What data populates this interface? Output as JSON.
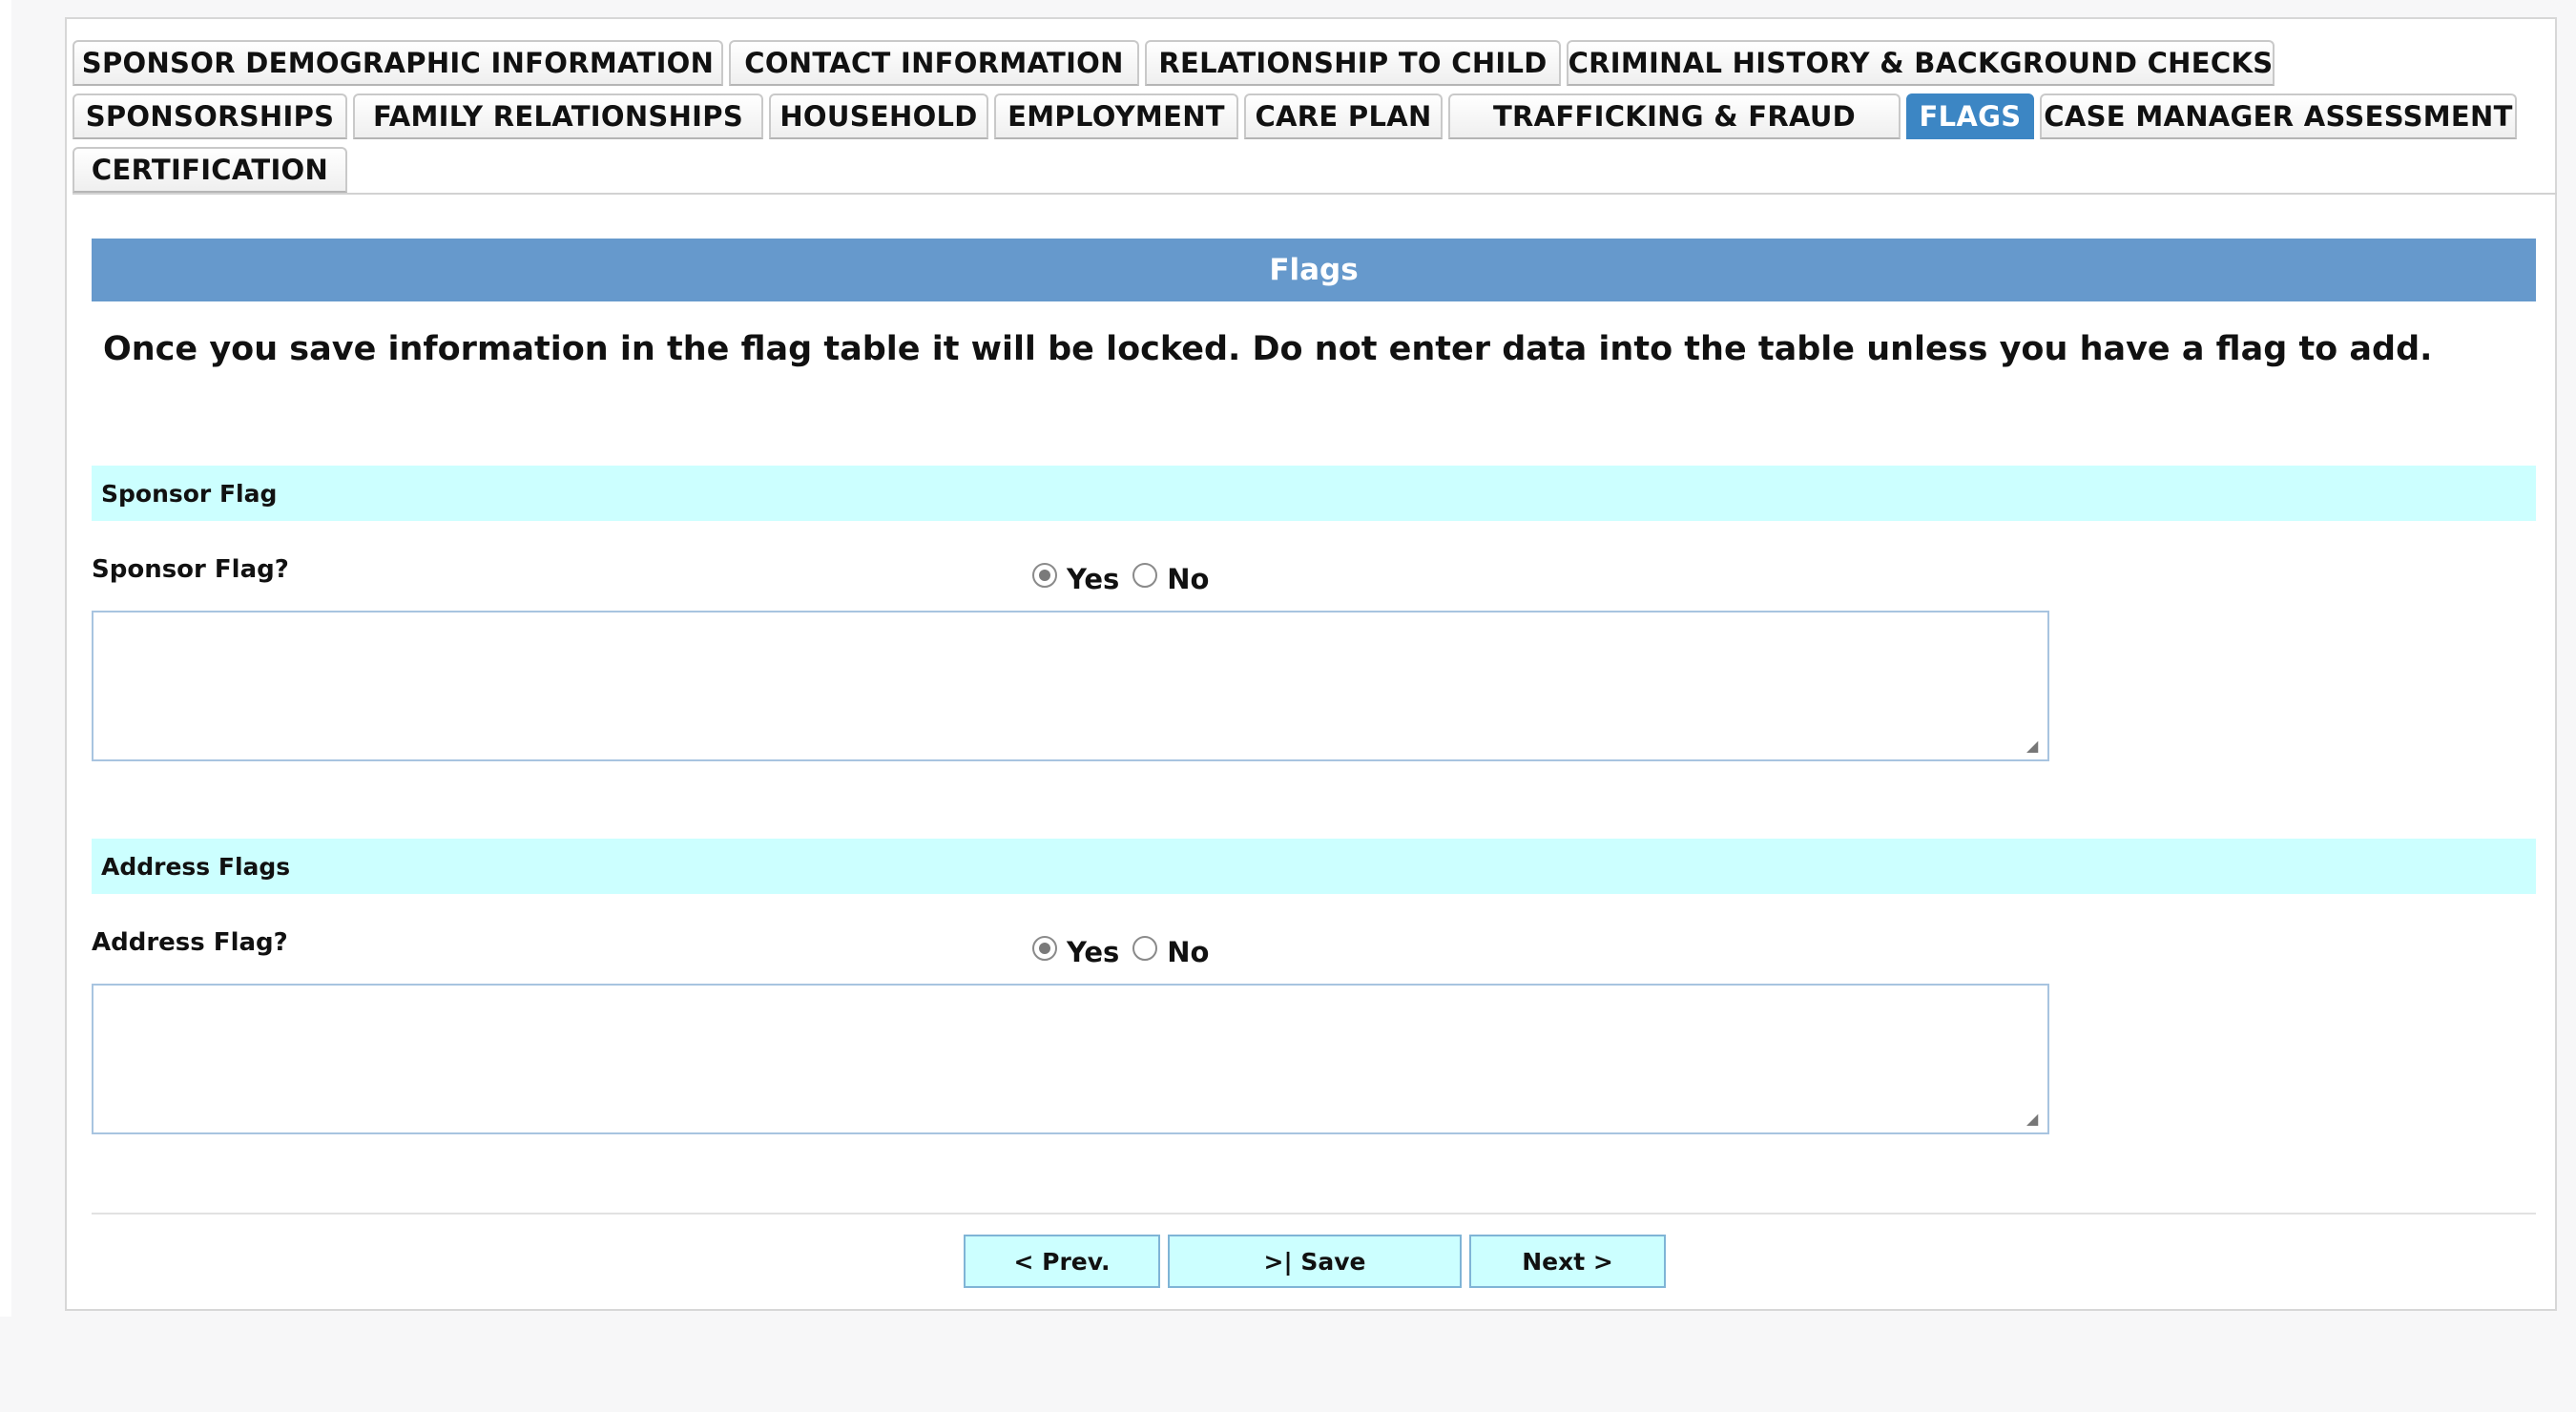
{
  "tabs": {
    "row1": [
      {
        "label": "SPONSOR DEMOGRAPHIC INFORMATION"
      },
      {
        "label": "CONTACT INFORMATION"
      },
      {
        "label": "RELATIONSHIP TO CHILD"
      },
      {
        "label": "CRIMINAL HISTORY & BACKGROUND CHECKS"
      }
    ],
    "row2": [
      {
        "label": "SPONSORSHIPS"
      },
      {
        "label": "FAMILY RELATIONSHIPS"
      },
      {
        "label": "HOUSEHOLD"
      },
      {
        "label": "EMPLOYMENT"
      },
      {
        "label": "CARE PLAN"
      },
      {
        "label": "TRAFFICKING & FRAUD"
      },
      {
        "label": "FLAGS",
        "active": true
      },
      {
        "label": "CASE MANAGER ASSESSMENT"
      }
    ],
    "row3": [
      {
        "label": "CERTIFICATION"
      }
    ]
  },
  "section": {
    "title": "Flags",
    "notice": "Once you save information in the flag table it will be locked. Do not enter data into the table unless you have a flag to add."
  },
  "sponsor_flag": {
    "header": "Sponsor Flag",
    "question": "Sponsor Flag?",
    "options": {
      "yes": "Yes",
      "no": "No"
    },
    "selected": "Yes",
    "details": ""
  },
  "address_flags": {
    "header": "Address Flags",
    "question": "Address Flag?",
    "options": {
      "yes": "Yes",
      "no": "No"
    },
    "selected": "Yes",
    "details": ""
  },
  "buttons": {
    "prev": "< Prev.",
    "save": ">| Save",
    "next": "Next >"
  },
  "colors": {
    "active_tab": "#3c86c4",
    "section_header": "#6699cc",
    "subheader": "#ccffff",
    "button_bg": "#ccffff"
  }
}
